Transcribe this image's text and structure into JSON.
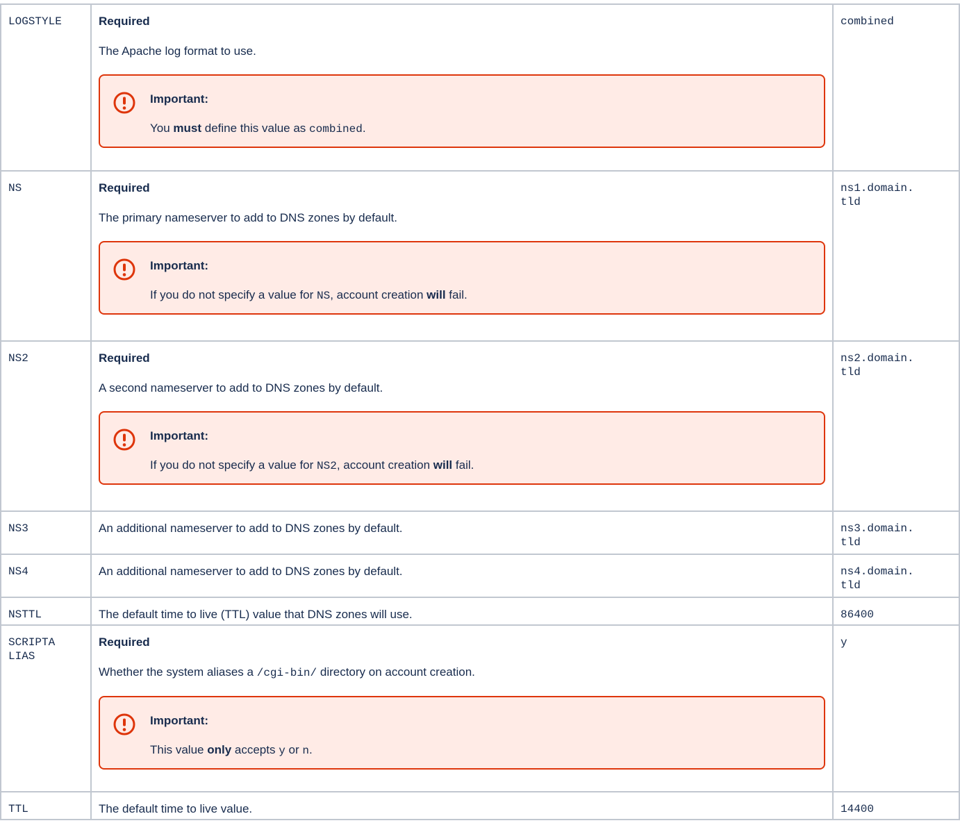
{
  "important_label": "Important:",
  "rows": {
    "logstyle": {
      "key": "LOGSTYLE",
      "required": "Required",
      "desc": "The Apache log format to use.",
      "note": {
        "pre": "You ",
        "bold": "must",
        "mid": " define this value as ",
        "code": "combined",
        "post": "."
      },
      "default": "combined"
    },
    "ns": {
      "key": "NS",
      "required": "Required",
      "desc": "The primary nameserver to add to DNS zones by default.",
      "note": {
        "pre": "If you do not specify a value for ",
        "code": "NS",
        "mid": ", account creation ",
        "bold": "will",
        "post": " fail."
      },
      "default_1": "ns1.domain.",
      "default_2": "tld"
    },
    "ns2": {
      "key": "NS2",
      "required": "Required",
      "desc": "A second nameserver to add to DNS zones by default.",
      "note": {
        "pre": "If you do not specify a value for ",
        "code": "NS2",
        "mid": ", account creation ",
        "bold": "will",
        "post": " fail."
      },
      "default_1": "ns2.domain.",
      "default_2": "tld"
    },
    "ns3": {
      "key": "NS3",
      "desc": "An additional nameserver to add to DNS zones by default.",
      "default_1": "ns3.domain.",
      "default_2": "tld"
    },
    "ns4": {
      "key": "NS4",
      "desc": "An additional nameserver to add to DNS zones by default.",
      "default_1": "ns4.domain.",
      "default_2": "tld"
    },
    "nsttl": {
      "key": "NSTTL",
      "desc": "The default time to live (TTL) value that DNS zones will use.",
      "default": "86400"
    },
    "scriptalias": {
      "key_1": "SCRIPTA",
      "key_2": "LIAS",
      "required": "Required",
      "desc_pre": "Whether the system aliases a ",
      "desc_code": "/cgi-bin/",
      "desc_post": " directory on account creation.",
      "note": {
        "pre": "This value ",
        "bold": "only",
        "mid": " accepts ",
        "code1": "y",
        "or": " or ",
        "code2": "n",
        "post": "."
      },
      "default": "y"
    },
    "ttl": {
      "key": "TTL",
      "desc": "The default time to live value.",
      "default": "14400"
    }
  }
}
